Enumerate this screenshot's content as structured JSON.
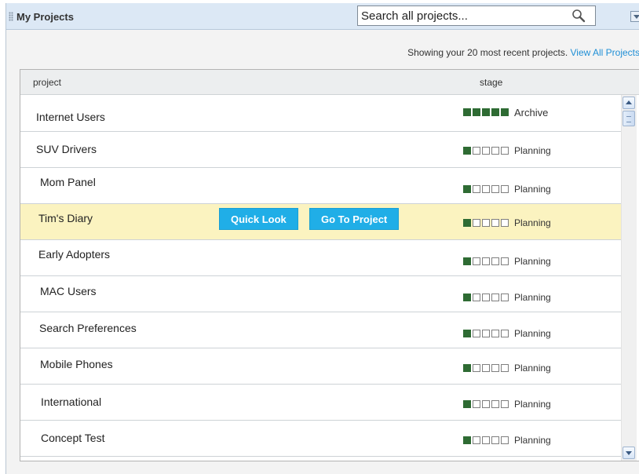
{
  "header": {
    "title": "My Projects",
    "search_placeholder": "Search all projects...",
    "search_icon": "magnifier-icon",
    "menu_icon": "dropdown-arrow-icon"
  },
  "info": {
    "text": "Showing your 20 most recent projects.",
    "link": "View All Projects"
  },
  "table": {
    "columns": [
      "project",
      "stage"
    ],
    "rows": [
      {
        "name": "Internet Users",
        "stage": "Archive",
        "filled": 5
      },
      {
        "name": "SUV Drivers",
        "stage": "Planning",
        "filled": 1
      },
      {
        "name": "Mom Panel",
        "stage": "Planning",
        "filled": 1
      },
      {
        "name": "Tim's Diary",
        "stage": "Planning",
        "filled": 1
      },
      {
        "name": "Early Adopters",
        "stage": "Planning",
        "filled": 1
      },
      {
        "name": "MAC Users",
        "stage": "Planning",
        "filled": 1
      },
      {
        "name": "Search Preferences",
        "stage": "Planning",
        "filled": 1
      },
      {
        "name": "Mobile Phones",
        "stage": "Planning",
        "filled": 1
      },
      {
        "name": "International",
        "stage": "Planning",
        "filled": 1
      },
      {
        "name": "Concept Test",
        "stage": "Planning",
        "filled": 1
      }
    ],
    "hover_actions": {
      "quick_look": "Quick Look",
      "go_to_project": "Go To Project"
    }
  },
  "colors": {
    "accent": "#20aee7",
    "highlight_row": "#fbf3c0",
    "stage_filled": "#2e6b33",
    "header_bg": "#dce8f5",
    "link": "#1f8fd6"
  }
}
